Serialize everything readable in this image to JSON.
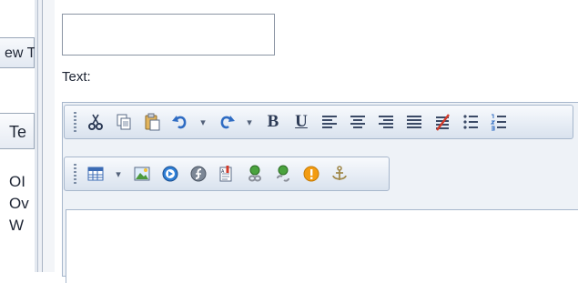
{
  "left_panel": {
    "tab_label": "ew T",
    "column_header": "Te",
    "list_items": [
      "OI",
      "Ov",
      "W"
    ]
  },
  "form": {
    "title_input_value": "",
    "text_label": "Text:"
  },
  "toolbar_row1": [
    "cut-icon",
    "copy-icon",
    "paste-icon",
    "undo-icon",
    "redo-icon",
    "bold-icon",
    "underline-icon",
    "align-left-icon",
    "align-center-icon",
    "align-right-icon",
    "justify-icon",
    "clear-formatting-icon",
    "bullet-list-icon",
    "numbered-list-icon"
  ],
  "toolbar_row2": [
    "table-icon",
    "image-icon",
    "media-icon",
    "flash-icon",
    "document-icon",
    "link-icon",
    "unlink-icon",
    "warning-icon",
    "anchor-icon"
  ],
  "colors": {
    "toolbar_border": "#a7b7cc",
    "toolbar_gradient_top": "#f8fafd",
    "toolbar_gradient_bottom": "#d9e2ee",
    "icon_blue": "#3b78c9",
    "warning_orange": "#f39c12"
  }
}
